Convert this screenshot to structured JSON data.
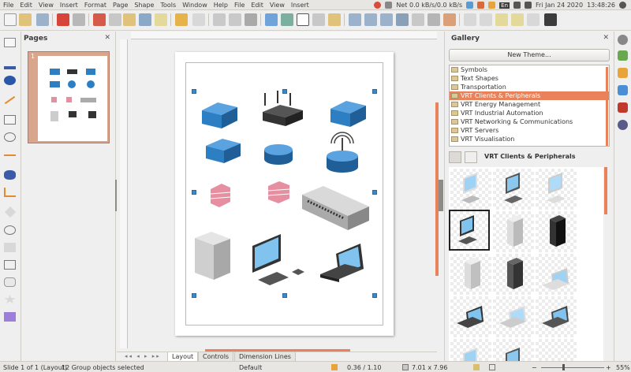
{
  "menubar": {
    "items": [
      "File",
      "Edit",
      "View",
      "Insert",
      "Format",
      "Page",
      "Shape",
      "Tools",
      "Window",
      "Help",
      "File",
      "Edit",
      "View",
      "Insert"
    ],
    "net": "Net 0.0 kB/s/0.0 kB/s",
    "lang": "En",
    "date": "Fri Jan 24 2020",
    "time": "13:48:26"
  },
  "pages_panel": {
    "title": "Pages",
    "page_number": "1"
  },
  "tabs": [
    "Layout",
    "Controls",
    "Dimension Lines"
  ],
  "gallery": {
    "title": "Gallery",
    "new_theme_label": "New Theme...",
    "themes": [
      "Symbols",
      "Text Shapes",
      "Transportation",
      "VRT Clients & Peripherals",
      "VRT Energy Management",
      "VRT Industrial Automation",
      "VRT Networking & Communications",
      "VRT Servers",
      "VRT Visualisation"
    ],
    "selected_theme": "VRT Clients & Peripherals"
  },
  "status": {
    "slide": "Slide 1 of 1 (Layout)",
    "selection": "12 Group objects selected",
    "master": "Default",
    "position": "0.36 / 1.10",
    "size": "7.01 x 7.96",
    "zoom": "55%"
  },
  "zoom_fraction": 0.55,
  "colors": {
    "accent": "#e9825a",
    "selection_handle": "#3b87c8",
    "network_blue": "#2d7fc4",
    "firewall_red": "#e68fa0"
  }
}
